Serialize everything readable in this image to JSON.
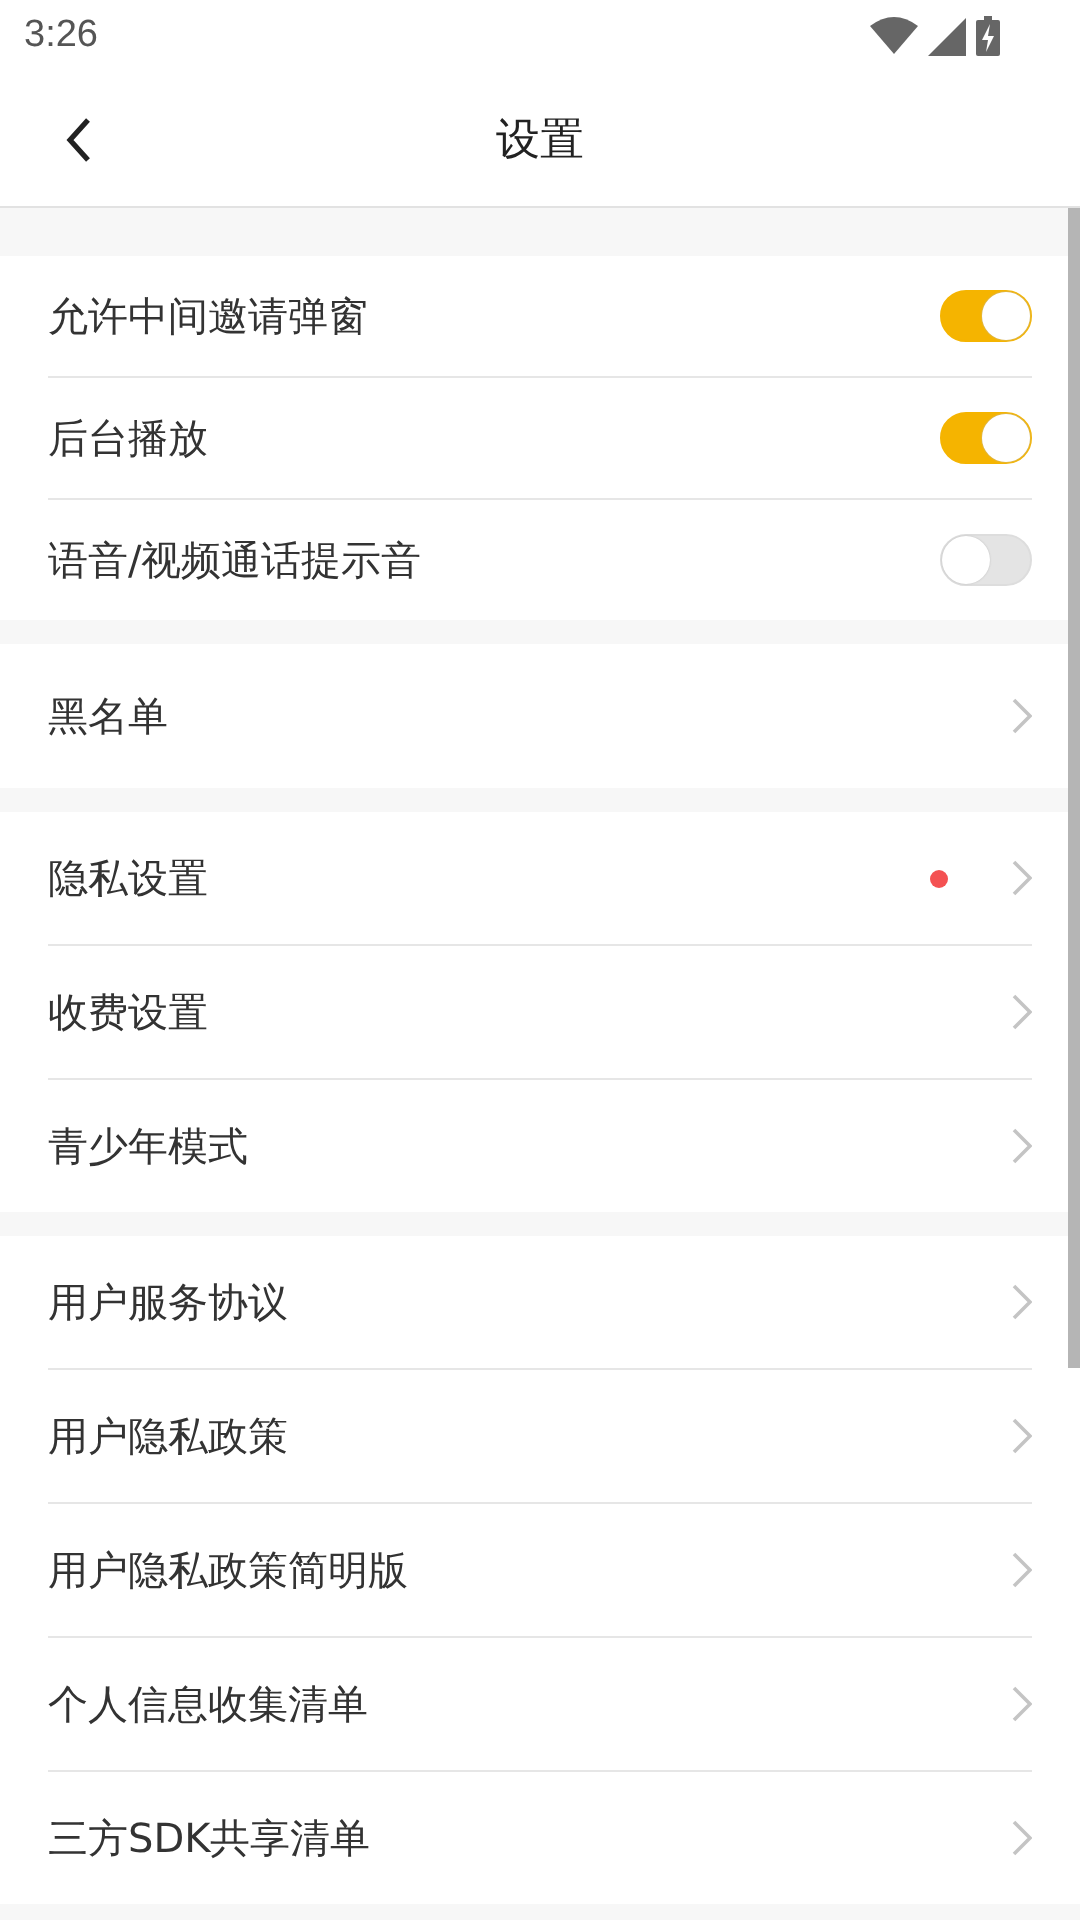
{
  "status_bar": {
    "time": "3:26"
  },
  "header": {
    "title": "设置"
  },
  "groups": [
    {
      "rows": [
        {
          "kind": "toggle",
          "label": "允许中间邀请弹窗",
          "on": true
        },
        {
          "kind": "toggle",
          "label": "后台播放",
          "on": true
        },
        {
          "kind": "toggle",
          "label": "语音/视频通话提示音",
          "on": false
        }
      ]
    },
    {
      "rows": [
        {
          "kind": "link",
          "label": "黑名单",
          "dot": false
        }
      ]
    },
    {
      "rows": [
        {
          "kind": "link",
          "label": "隐私设置",
          "dot": true
        },
        {
          "kind": "link",
          "label": "收费设置",
          "dot": false
        },
        {
          "kind": "link",
          "label": "青少年模式",
          "dot": false
        }
      ]
    },
    {
      "rows": [
        {
          "kind": "link",
          "label": "用户服务协议",
          "dot": false
        },
        {
          "kind": "link",
          "label": "用户隐私政策",
          "dot": false
        },
        {
          "kind": "link",
          "label": "用户隐私政策简明版",
          "dot": false
        },
        {
          "kind": "link",
          "label": "个人信息收集清单",
          "dot": false
        },
        {
          "kind": "link",
          "label": "三方SDK共享清单",
          "dot": false
        }
      ]
    }
  ]
}
